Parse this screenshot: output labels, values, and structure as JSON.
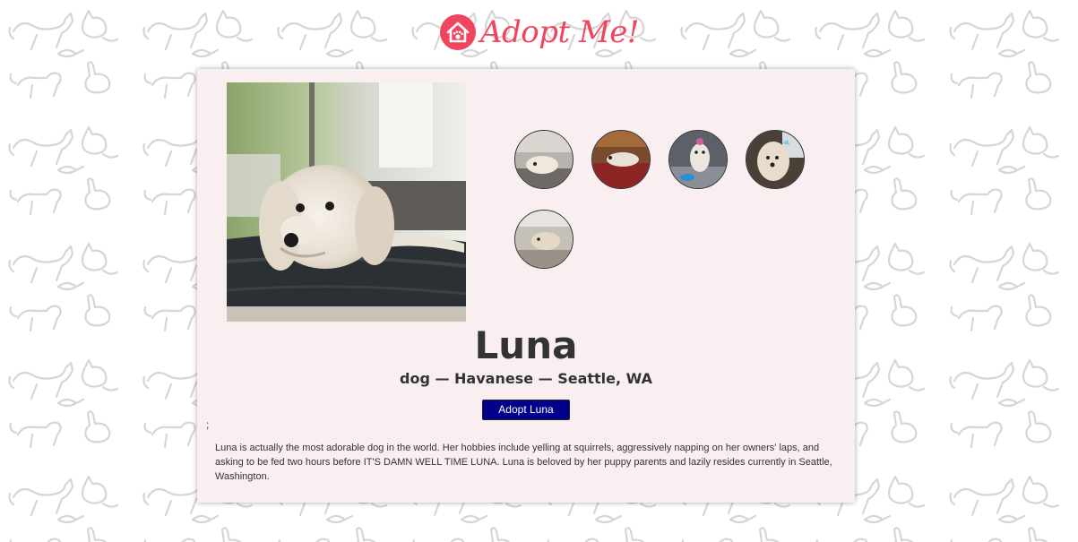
{
  "brand": {
    "name": "Adopt Me!",
    "color": "#f0455f"
  },
  "pet": {
    "name": "Luna",
    "meta": "dog — Havanese — Seattle, WA",
    "adopt_label": "Adopt Luna",
    "stray_text": ";",
    "description": "Luna is actually the most adorable dog in the world. Her hobbies include yelling at squirrels, aggressively napping on her owners' laps, and asking to be fed two hours before IT'S DAMN WELL TIME LUNA. Luna is beloved by her puppy parents and lazily resides currently in Seattle, Washington."
  },
  "photos": {
    "hero": "white-havanese-dog-lying-in-suitcase",
    "thumbnails": [
      "dog-lying-on-bed",
      "dog-on-red-couch",
      "dog-with-bow-on-floor",
      "dog-close-up-with-blue-bow",
      "dog-lying-on-rug"
    ]
  },
  "colors": {
    "card_background": "#faeff0",
    "button_background": "#00008b",
    "text": "#333333",
    "pattern": "#d9d9d9"
  }
}
